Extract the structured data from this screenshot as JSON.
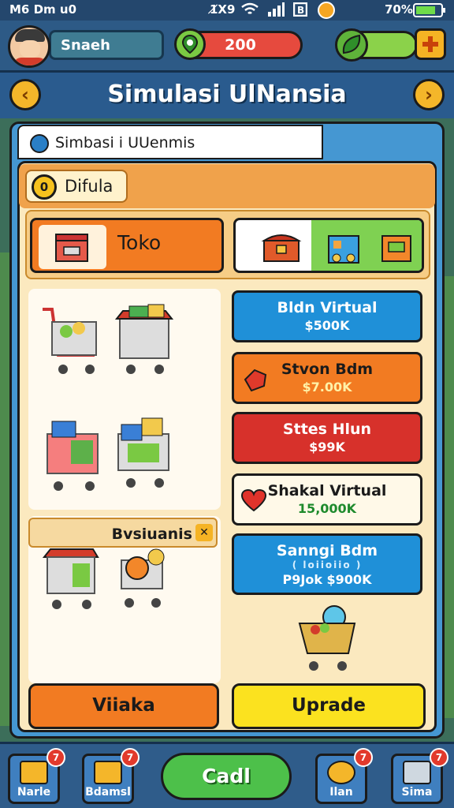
{
  "status": {
    "left": "M6 Dm u0",
    "time": "1̸X9",
    "battery": "70%"
  },
  "topbar": {
    "player_name": "Snaeh",
    "coins": "200"
  },
  "title": "Simulasi UlNansia",
  "subtitle": "Simbasi i UUenmis",
  "tab": {
    "coin_glyph": "0",
    "label": "Difula"
  },
  "shop": {
    "toko_label": "Toko"
  },
  "cards": [
    {
      "title": "Bldn Virtual",
      "price": "$500K"
    },
    {
      "title": "Stvon Bdm",
      "price": "$7.00K"
    },
    {
      "title": "Sttes Hlun",
      "price": "$99K"
    },
    {
      "title": "Shakal Virtual",
      "price": "15,000K"
    },
    {
      "title": "Sanngi Bdm",
      "sub": "( loiioiio )",
      "price": "P9Jok $900K"
    }
  ],
  "subsection": {
    "label": "Bvsiuanis"
  },
  "buttons": {
    "viaka": "Viiaka",
    "upgrade": "Uprade"
  },
  "nav": {
    "item1": "Narle",
    "item2": "Bdamsl",
    "center": "Cadl",
    "item4": "Ilan",
    "item5": "Sima",
    "badge": "7"
  },
  "colors": {
    "accent": "#f27b22",
    "panel": "#4597d2",
    "upgrade": "#fbe21f"
  }
}
